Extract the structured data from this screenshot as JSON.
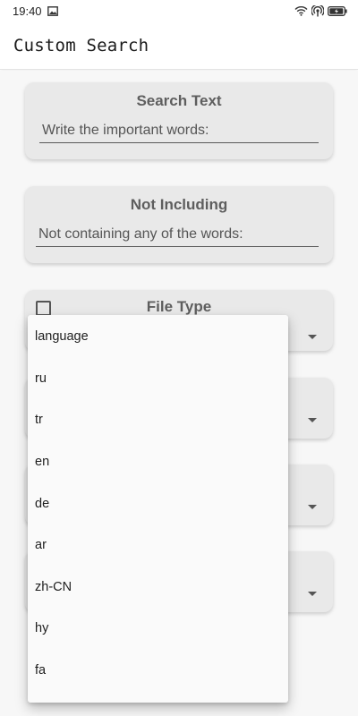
{
  "status_bar": {
    "time": "19:40",
    "icons": [
      "image-icon",
      "wifi-icon",
      "hotspot-icon",
      "battery-icon"
    ]
  },
  "app_bar": {
    "title": "Custom Search"
  },
  "cards": {
    "search_text": {
      "title": "Search Text",
      "placeholder": "Write the important words:"
    },
    "not_including": {
      "title": "Not Including",
      "placeholder": "Not containing any of the words:"
    },
    "file_type": {
      "title": "File Type",
      "checked": false
    }
  },
  "language_dropdown": {
    "options": [
      "language",
      "ru",
      "tr",
      "en",
      "de",
      "ar",
      "zh-CN",
      "hy",
      "fa"
    ]
  },
  "colors": {
    "card_bg": "#e9e9e9",
    "content_bg": "#f7f7f7",
    "card_title": "#5e5e5e",
    "dropdown_bg": "#fafafa"
  }
}
